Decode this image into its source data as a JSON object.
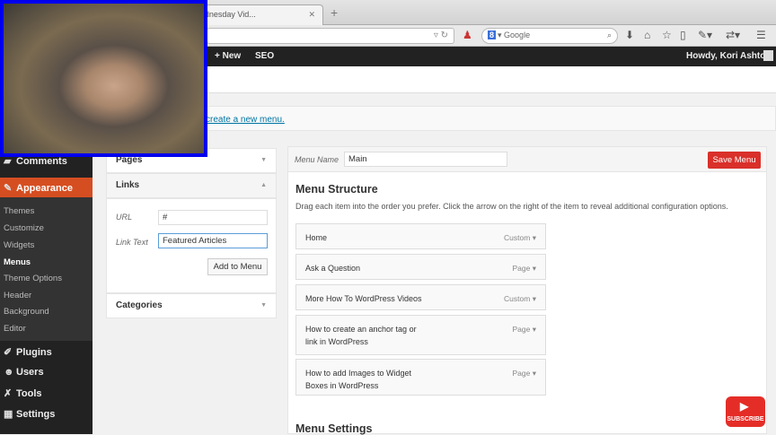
{
  "browser": {
    "tab_title": "Press Wednesday Vid...",
    "search_placeholder": "Google",
    "search_engine": "8"
  },
  "adminbar": {
    "new": "+ New",
    "seo": "SEO",
    "howdy": "Howdy, Kori Ashton"
  },
  "notice": {
    "link": "create a new menu."
  },
  "sidebar": {
    "comments": "Comments",
    "appearance": "Appearance",
    "sub": [
      "Themes",
      "Customize",
      "Widgets",
      "Menus",
      "Theme Options",
      "Header",
      "Background",
      "Editor"
    ],
    "plugins": "Plugins",
    "users": "Users",
    "tools": "Tools",
    "settings": "Settings"
  },
  "left": {
    "pages": "Pages",
    "links": "Links",
    "url_label": "URL",
    "url_value": "#",
    "link_text_label": "Link Text",
    "link_text_value": "Featured Articles",
    "add_button": "Add to Menu",
    "categories": "Categories"
  },
  "main": {
    "menu_name_label": "Menu Name",
    "menu_name_value": "Main",
    "save": "Save Menu",
    "structure_title": "Menu Structure",
    "structure_desc": "Drag each item into the order you prefer. Click the arrow on the right of the item to reveal additional configuration options.",
    "items": [
      {
        "title": "Home",
        "type": "Custom"
      },
      {
        "title": "Ask a Question",
        "type": "Page"
      },
      {
        "title": "More How To WordPress Videos",
        "type": "Custom"
      },
      {
        "title": "How to create an anchor tag or link in WordPress",
        "type": "Page"
      },
      {
        "title": "How to add Images to Widget Boxes in WordPress",
        "type": "Page"
      }
    ],
    "settings_title": "Menu Settings"
  },
  "overlay": {
    "subscribe": "SUBSCRIBE"
  }
}
